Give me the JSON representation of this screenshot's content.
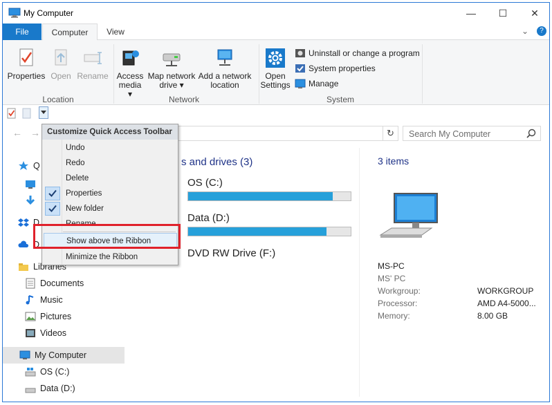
{
  "window": {
    "title": "My Computer",
    "minimize": "—",
    "maximize": "☐",
    "close": "✕"
  },
  "tabs": {
    "file": "File",
    "computer": "Computer",
    "view": "View",
    "expand": "⌄",
    "help": "?"
  },
  "ribbon": {
    "location": {
      "label": "Location",
      "properties": "Properties",
      "open": "Open",
      "rename": "Rename"
    },
    "network": {
      "label": "Network",
      "access_media_1": "Access",
      "access_media_2": "media ▾",
      "map_drive_1": "Map network",
      "map_drive_2": "drive ▾",
      "add_location_1": "Add a network",
      "add_location_2": "location"
    },
    "system": {
      "label": "System",
      "open_settings_1": "Open",
      "open_settings_2": "Settings",
      "uninstall": "Uninstall or change a program",
      "system_props": "System properties",
      "manage": "Manage"
    }
  },
  "search": {
    "placeholder": "Search My Computer"
  },
  "navtree": {
    "quick_access_partial": "Q",
    "onedrive_partial_1": "D",
    "onedrive_partial_2": "D",
    "libraries": "Libraries",
    "documents": "Documents",
    "music": "Music",
    "pictures": "Pictures",
    "videos": "Videos",
    "my_computer": "My Computer",
    "os_c": "OS (C:)",
    "data_d": "Data (D:)"
  },
  "content": {
    "group_title": "s and drives (3)",
    "drives": [
      {
        "name": "OS (C:)",
        "usage": 0.89
      },
      {
        "name": "Data (D:)",
        "usage": 0.85
      },
      {
        "name": "DVD RW Drive (F:)"
      }
    ]
  },
  "details": {
    "count": "3 items",
    "pc_name": "MS-PC",
    "pc_sub": "MS' PC",
    "rows": [
      {
        "label": "Workgroup:",
        "value": "WORKGROUP"
      },
      {
        "label": "Processor:",
        "value": "AMD A4-5000..."
      },
      {
        "label": "Memory:",
        "value": "8.00 GB"
      }
    ]
  },
  "menu": {
    "header": "Customize Quick Access Toolbar",
    "items": [
      {
        "label": "Undo",
        "checked": false
      },
      {
        "label": "Redo",
        "checked": false
      },
      {
        "label": "Delete",
        "checked": false
      },
      {
        "label": "Properties",
        "checked": true
      },
      {
        "label": "New folder",
        "checked": true
      },
      {
        "label": "Rename",
        "checked": false
      }
    ],
    "show_above": "Show above the Ribbon",
    "minimize": "Minimize the Ribbon"
  },
  "colors": {
    "accent": "#1979ca",
    "highlight": "#e0212b",
    "drive_fill": "#26a0da"
  }
}
